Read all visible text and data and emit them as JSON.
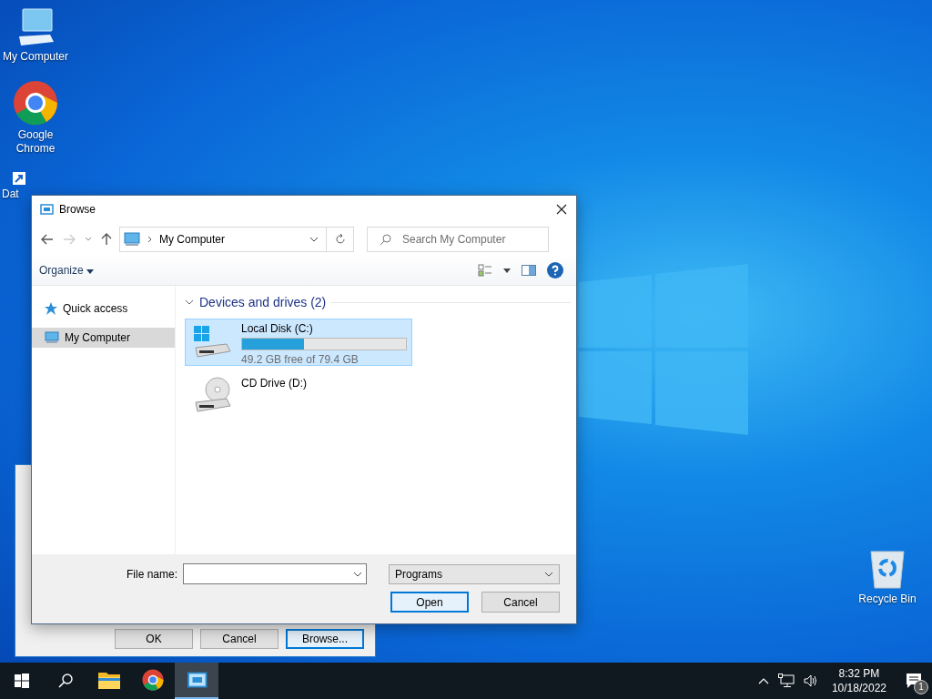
{
  "desktop": {
    "icons": [
      {
        "label": "My Computer",
        "kind": "computer"
      },
      {
        "label": "Google Chrome",
        "kind": "chrome"
      },
      {
        "label": "Dat",
        "kind": "shortcut"
      }
    ],
    "right_icons": [
      {
        "label": "Recycle Bin",
        "kind": "recycle"
      }
    ]
  },
  "back_window": {
    "buttons": [
      {
        "label": "OK",
        "default": false
      },
      {
        "label": "Cancel",
        "default": false
      },
      {
        "label": "Browse...",
        "default": true
      }
    ]
  },
  "dialog": {
    "title": "Browse",
    "address": "My Computer",
    "search": {
      "placeholder": "Search My Computer"
    },
    "organize": "Organize",
    "nav": [
      {
        "label": "Quick access",
        "kind": "star",
        "selected": false
      },
      {
        "label": "My Computer",
        "kind": "computer",
        "selected": true
      }
    ],
    "group": {
      "heading": "Devices and drives (2)",
      "expanded": true
    },
    "drives": [
      {
        "name": "Local Disk (C:)",
        "kind": "hdd",
        "selected": true,
        "level": 0.38,
        "free": "49.2 GB free of 79.4 GB"
      },
      {
        "name": "CD Drive (D:)",
        "kind": "cd",
        "selected": false
      }
    ],
    "file_name_label": "File name:",
    "file_type": "Programs",
    "buttons": [
      {
        "label": "Open",
        "default": true
      },
      {
        "label": "Cancel",
        "default": false
      }
    ]
  },
  "taskbar": {
    "apps": [
      {
        "kind": "explorer",
        "active": false
      },
      {
        "kind": "chrome",
        "active": false
      },
      {
        "kind": "browse",
        "active": true
      }
    ],
    "time": "8:32 PM",
    "date": "10/18/2022",
    "notifications": "1"
  }
}
